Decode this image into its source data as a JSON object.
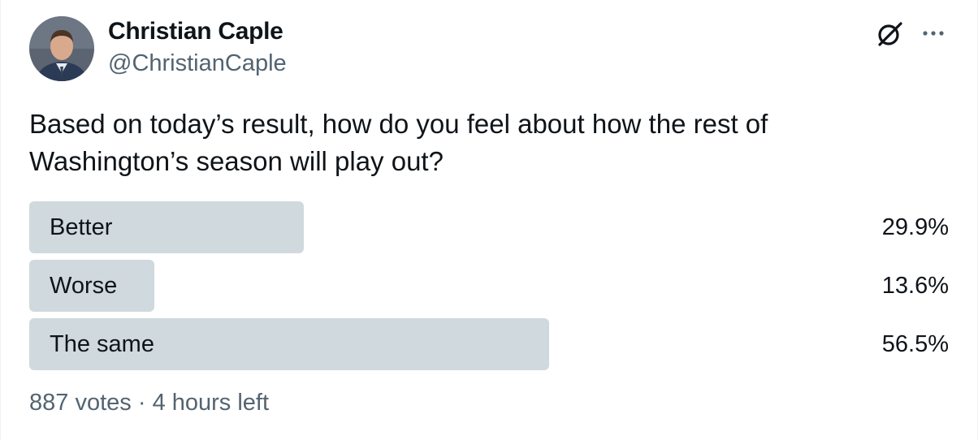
{
  "author": {
    "display_name": "Christian Caple",
    "handle": "@ChristianCaple",
    "avatar_icon": "avatar-photo"
  },
  "header_icons": [
    "grok-icon",
    "more-options-icon"
  ],
  "tweet": {
    "text": "Based on today’s result, how do you feel about how the rest of Washington’s season will play out?"
  },
  "poll": {
    "options": [
      {
        "label": "Better",
        "percent_text": "29.9%",
        "percent": 29.9
      },
      {
        "label": "Worse",
        "percent_text": "13.6%",
        "percent": 13.6
      },
      {
        "label": "The same",
        "percent_text": "56.5%",
        "percent": 56.5
      }
    ],
    "votes": "887 votes",
    "separator": "·",
    "time_left": "4 hours left"
  },
  "colors": {
    "bar": "#cfd9de",
    "secondary_text": "#536471",
    "primary_text": "#0f1419"
  }
}
